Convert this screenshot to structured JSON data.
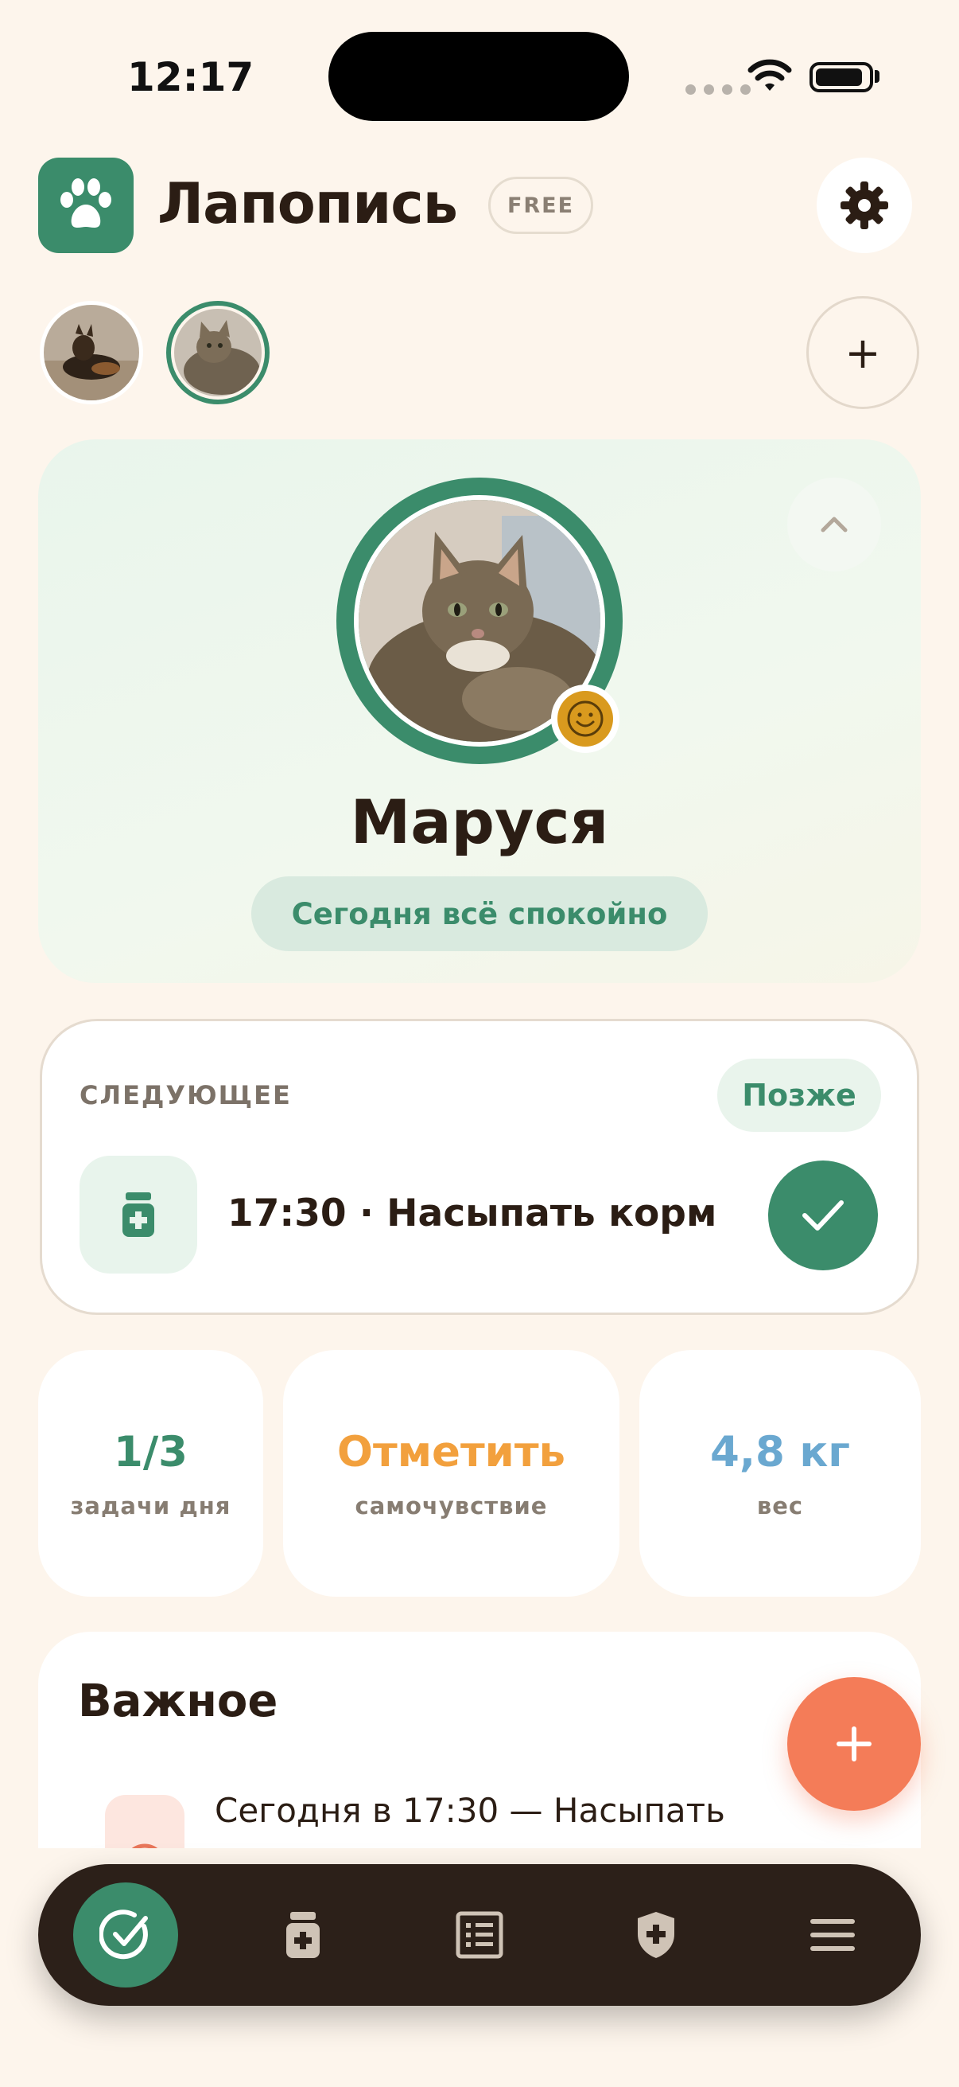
{
  "status_bar": {
    "time": "12:17"
  },
  "header": {
    "app_name": "Лапопись",
    "plan_badge": "FREE",
    "logo_icon": "paw-icon",
    "settings_icon": "gear-icon"
  },
  "pets": {
    "items": [
      {
        "name": "dog",
        "selected": false
      },
      {
        "name": "cat",
        "selected": true
      }
    ],
    "add_label": "+"
  },
  "profile": {
    "name": "Маруся",
    "status": "Сегодня всё спокойно",
    "mood_icon": "smile-icon",
    "collapse_icon": "chevron-up-icon"
  },
  "next": {
    "label": "СЛЕДУЮЩЕЕ",
    "later_label": "Позже",
    "task_text": "17:30 · Насыпать корм",
    "task_icon": "medicine-jar-icon",
    "done_icon": "check-icon"
  },
  "stats": {
    "tasks": {
      "value": "1/3",
      "label": "задачи дня"
    },
    "mood": {
      "value": "Отметить",
      "label": "самочувствие"
    },
    "weight": {
      "value": "4,8 кг",
      "label": "вес"
    }
  },
  "important": {
    "title": "Важное",
    "item_text": "Сегодня в 17:30 — Насыпать",
    "item_icon": "clock-icon"
  },
  "fab": {
    "label": "+"
  },
  "tab_bar": {
    "items": [
      {
        "name": "tasks",
        "icon": "check-circle-icon",
        "active": true
      },
      {
        "name": "meds",
        "icon": "medicine-jar-icon",
        "active": false
      },
      {
        "name": "journal",
        "icon": "list-icon",
        "active": false
      },
      {
        "name": "health",
        "icon": "shield-icon",
        "active": false
      },
      {
        "name": "menu",
        "icon": "menu-icon",
        "active": false
      }
    ]
  },
  "colors": {
    "background": "#fdf5ec",
    "accent": "#3b8c6b",
    "orange": "#f2a03d",
    "blue": "#6aa8d0",
    "fab": "#f47c58",
    "tabbar": "#2c2019"
  }
}
